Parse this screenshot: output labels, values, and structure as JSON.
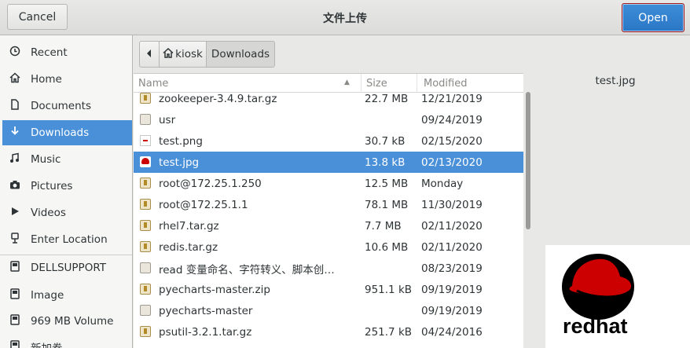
{
  "header": {
    "title": "文件上传",
    "cancel_label": "Cancel",
    "open_label": "Open"
  },
  "sidebar": {
    "items": [
      {
        "label": "Recent",
        "icon": "clock-icon"
      },
      {
        "label": "Home",
        "icon": "home-icon"
      },
      {
        "label": "Documents",
        "icon": "document-icon"
      },
      {
        "label": "Downloads",
        "icon": "download-icon",
        "selected": true
      },
      {
        "label": "Music",
        "icon": "music-icon"
      },
      {
        "label": "Pictures",
        "icon": "camera-icon"
      },
      {
        "label": "Videos",
        "icon": "video-icon"
      },
      {
        "label": "Enter Location",
        "icon": "location-icon"
      },
      {
        "label": "DELLSUPPORT",
        "icon": "drive-icon"
      },
      {
        "label": "Image",
        "icon": "drive-icon"
      },
      {
        "label": "969 MB Volume",
        "icon": "drive-icon"
      },
      {
        "label": "新加卷",
        "icon": "drive-icon"
      }
    ]
  },
  "pathbar": {
    "segments": [
      "kiosk",
      "Downloads"
    ]
  },
  "columns": {
    "name": "Name",
    "size": "Size",
    "modified": "Modified"
  },
  "files": [
    {
      "name": "zookeeper-3.4.9.tar.gz",
      "size": "22.7 MB",
      "modified": "12/21/2019",
      "type": "archive"
    },
    {
      "name": "usr",
      "size": "",
      "modified": "09/24/2019",
      "type": "folder"
    },
    {
      "name": "test.png",
      "size": "30.7 kB",
      "modified": "02/15/2020",
      "type": "image"
    },
    {
      "name": "test.jpg",
      "size": "13.8 kB",
      "modified": "02/13/2020",
      "type": "image-red",
      "selected": true
    },
    {
      "name": "root@172.25.1.250",
      "size": "12.5 MB",
      "modified": "Monday",
      "type": "archive"
    },
    {
      "name": "root@172.25.1.1",
      "size": "78.1 MB",
      "modified": "11/30/2019",
      "type": "archive"
    },
    {
      "name": "rhel7.tar.gz",
      "size": "7.7 MB",
      "modified": "02/11/2020",
      "type": "archive"
    },
    {
      "name": "redis.tar.gz",
      "size": "10.6 MB",
      "modified": "02/11/2020",
      "type": "archive"
    },
    {
      "name": "read 变量命名、字符转义、脚本创…",
      "size": "",
      "modified": "08/23/2019",
      "type": "folder"
    },
    {
      "name": "pyecharts-master.zip",
      "size": "951.1 kB",
      "modified": "09/19/2019",
      "type": "archive"
    },
    {
      "name": "pyecharts-master",
      "size": "",
      "modified": "09/19/2019",
      "type": "folder"
    },
    {
      "name": "psutil-3.2.1.tar.gz",
      "size": "251.7 kB",
      "modified": "04/24/2016",
      "type": "archive"
    }
  ],
  "preview": {
    "filename": "test.jpg",
    "logo_text": "redhat"
  },
  "colors": {
    "accent": "#4a90d9",
    "open_border": "#a31919",
    "redhat_red": "#cc0000"
  }
}
